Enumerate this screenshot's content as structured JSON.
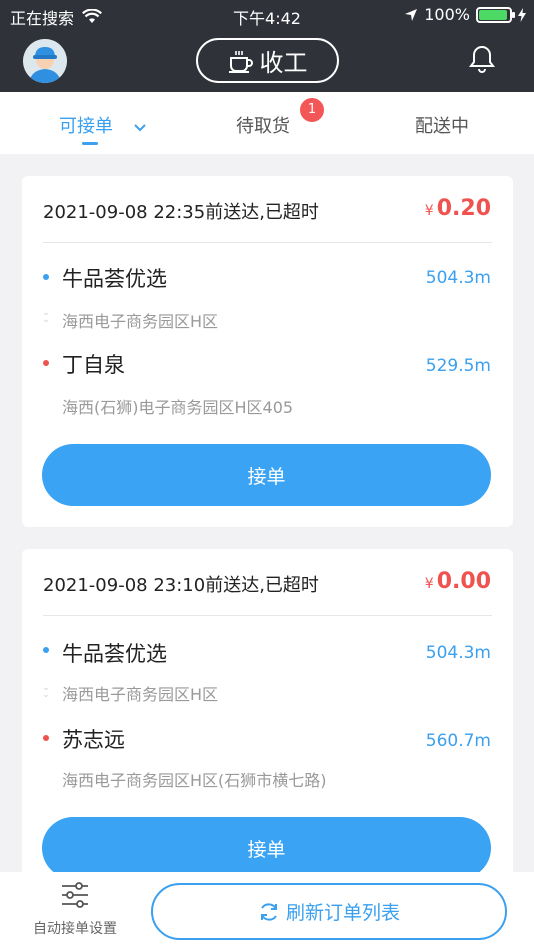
{
  "status_bar": {
    "carrier": "正在搜索",
    "time": "下午4:42",
    "battery": "100%"
  },
  "header": {
    "clockout_label": "收工",
    "avatar": "rider-avatar",
    "bell_icon": "bell-icon"
  },
  "tabs": [
    {
      "label": "可接单",
      "active": true
    },
    {
      "label": "待取货",
      "badge": "1"
    },
    {
      "label": "配送中"
    }
  ],
  "orders": [
    {
      "deadline": "2021-09-08 22:35前送达,已超时",
      "currency": "¥",
      "price": "0.20",
      "pickup": {
        "name": "牛品荟优选",
        "address": "海西电子商务园区H区",
        "distance": "504.3m"
      },
      "dropoff": {
        "name": "丁自泉",
        "address": "海西(石狮)电子商务园区H区405",
        "distance": "529.5m"
      },
      "accept_label": "接单"
    },
    {
      "deadline": "2021-09-08 23:10前送达,已超时",
      "currency": "¥",
      "price": "0.00",
      "pickup": {
        "name": "牛品荟优选",
        "address": "海西电子商务园区H区",
        "distance": "504.3m"
      },
      "dropoff": {
        "name": "苏志远",
        "address": "海西电子商务园区H区(石狮市横七路)",
        "distance": "560.7m"
      },
      "accept_label": "接单"
    }
  ],
  "bottom": {
    "auto_settings_label": "自动接单设置",
    "refresh_label": "刷新订单列表"
  },
  "colors": {
    "accent": "#3aa0ef",
    "price": "#ef5350",
    "header": "#2f3239"
  }
}
